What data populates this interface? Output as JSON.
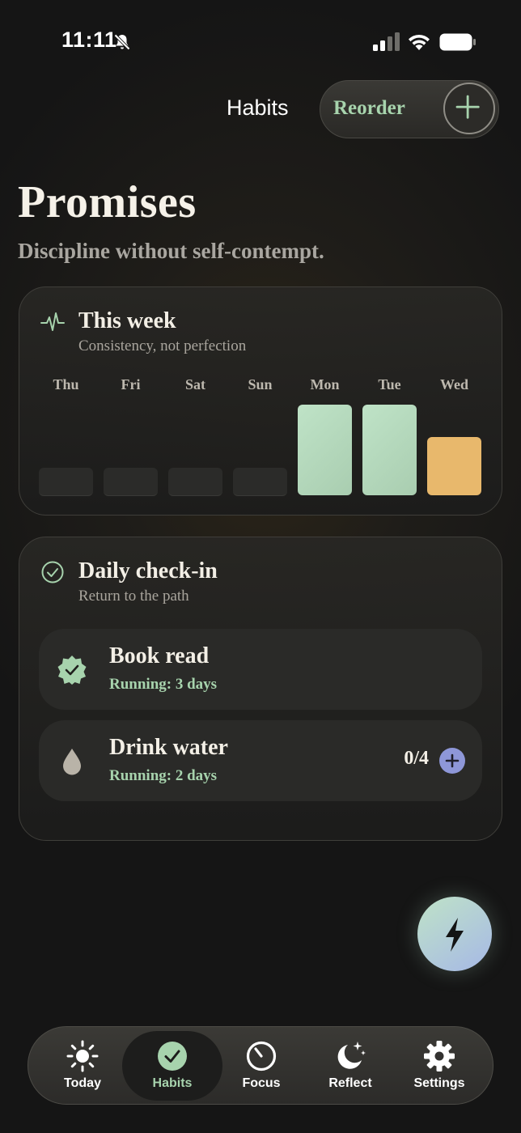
{
  "status_bar": {
    "time": "11:11"
  },
  "header": {
    "nav_title": "Habits",
    "reorder_label": "Reorder"
  },
  "page": {
    "title": "Promises",
    "subtitle": "Discipline without self-contempt."
  },
  "week_card": {
    "title": "This week",
    "subtitle": "Consistency, not perfection",
    "days": [
      {
        "label": "Thu",
        "completion": 0
      },
      {
        "label": "Fri",
        "completion": 0
      },
      {
        "label": "Sat",
        "completion": 0
      },
      {
        "label": "Sun",
        "completion": 0
      },
      {
        "label": "Mon",
        "completion": 1.0
      },
      {
        "label": "Tue",
        "completion": 1.0
      },
      {
        "label": "Wed",
        "completion": 0.5
      }
    ],
    "colors": {
      "complete": "#bfe3c7",
      "partial": "#e8b86c"
    }
  },
  "checkin_card": {
    "title": "Daily check-in",
    "subtitle": "Return to the path",
    "habits": [
      {
        "name": "Book read",
        "streak": "Running: 3 days",
        "icon": "check-badge-icon"
      },
      {
        "name": "Drink water",
        "streak": "Running: 2 days",
        "icon": "water-drop-icon",
        "count": "0/4"
      }
    ]
  },
  "tabbar": {
    "tabs": [
      {
        "label": "Today",
        "icon": "sun-icon"
      },
      {
        "label": "Habits",
        "icon": "check-circle-icon",
        "active": true
      },
      {
        "label": "Focus",
        "icon": "timer-icon"
      },
      {
        "label": "Reflect",
        "icon": "moon-stars-icon"
      },
      {
        "label": "Settings",
        "icon": "gear-icon"
      }
    ]
  },
  "colors": {
    "accent_green": "#a7d3ad",
    "accent_purple": "#8e97d8",
    "accent_amber": "#e8b86c"
  }
}
